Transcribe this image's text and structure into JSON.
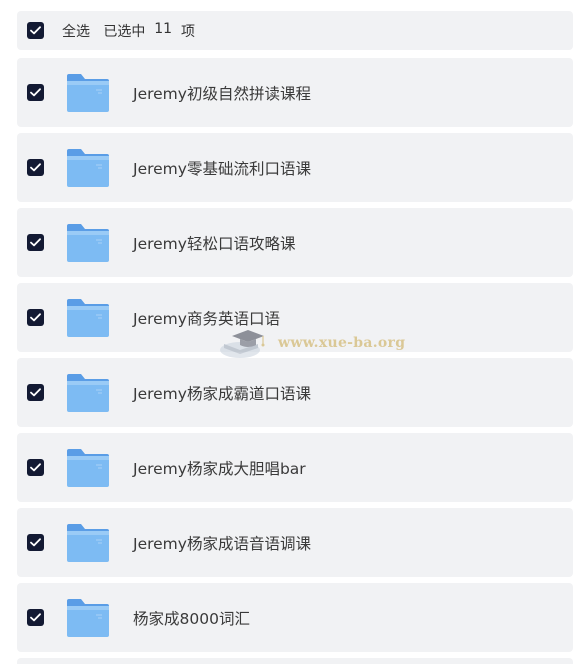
{
  "header": {
    "select_all_label": "全选",
    "selected_prefix": "已选中",
    "selected_count": "11",
    "selected_suffix": "项"
  },
  "items": [
    {
      "label": "Jeremy初级自然拼读课程",
      "checked": true
    },
    {
      "label": "Jeremy零基础流利口语课",
      "checked": true
    },
    {
      "label": "Jeremy轻松口语攻略课",
      "checked": true
    },
    {
      "label": "Jeremy商务英语口语",
      "checked": true
    },
    {
      "label": "Jeremy杨家成霸道口语课",
      "checked": true
    },
    {
      "label": "Jeremy杨家成大胆唱bar",
      "checked": true
    },
    {
      "label": "Jeremy杨家成语音语调课",
      "checked": true
    },
    {
      "label": "杨家成8000词汇",
      "checked": true
    }
  ],
  "watermark": {
    "text": "www.xue-ba.org"
  },
  "colors": {
    "checkbox": "#131a33",
    "row_background": "#f1f2f4",
    "folder_blue": "#6fb1ef"
  },
  "icons": {
    "checkbox": "check-icon",
    "folder": "folder-icon"
  }
}
